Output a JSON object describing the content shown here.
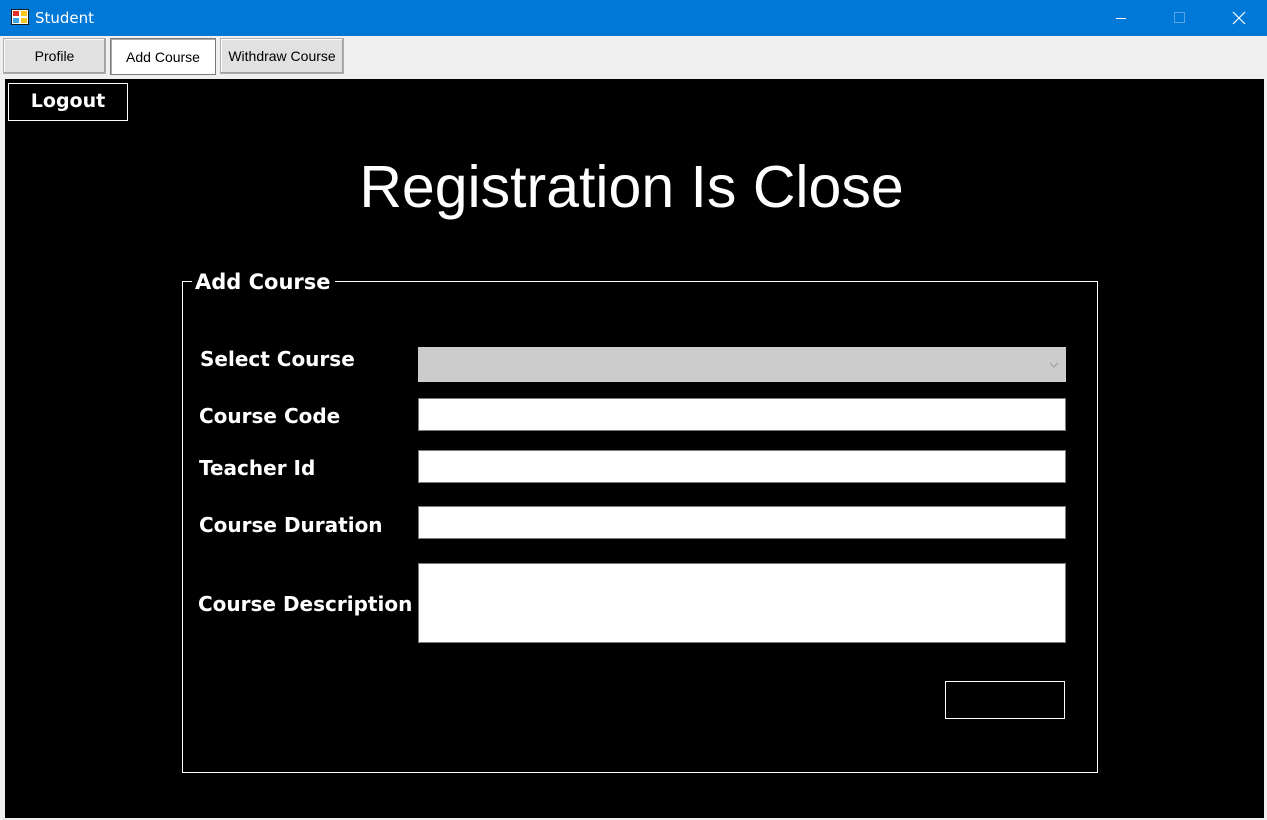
{
  "window": {
    "title": "Student",
    "app_icon": "winforms-app-icon",
    "controls": [
      "minimize-icon",
      "maximize-icon",
      "close-icon"
    ]
  },
  "tabs": [
    {
      "label": "Profile",
      "active": false
    },
    {
      "label": "Add Course",
      "active": true
    },
    {
      "label": "Withdraw Course",
      "active": false
    }
  ],
  "main": {
    "logout_label": "Logout",
    "headline": "Registration Is Close",
    "form": {
      "legend": "Add Course",
      "select_course": {
        "label": "Select Course",
        "value": "",
        "disabled": true
      },
      "course_code": {
        "label": "Course Code",
        "value": ""
      },
      "teacher_id": {
        "label": "Teacher Id",
        "value": ""
      },
      "course_duration": {
        "label": "Course Duration",
        "value": ""
      },
      "course_description": {
        "label": "Course Description",
        "value": ""
      },
      "submit_label": ""
    }
  },
  "colors": {
    "titlebar": "#0078d7",
    "background": "#000000",
    "text": "#ffffff",
    "disabled_combo": "#cccccc"
  }
}
